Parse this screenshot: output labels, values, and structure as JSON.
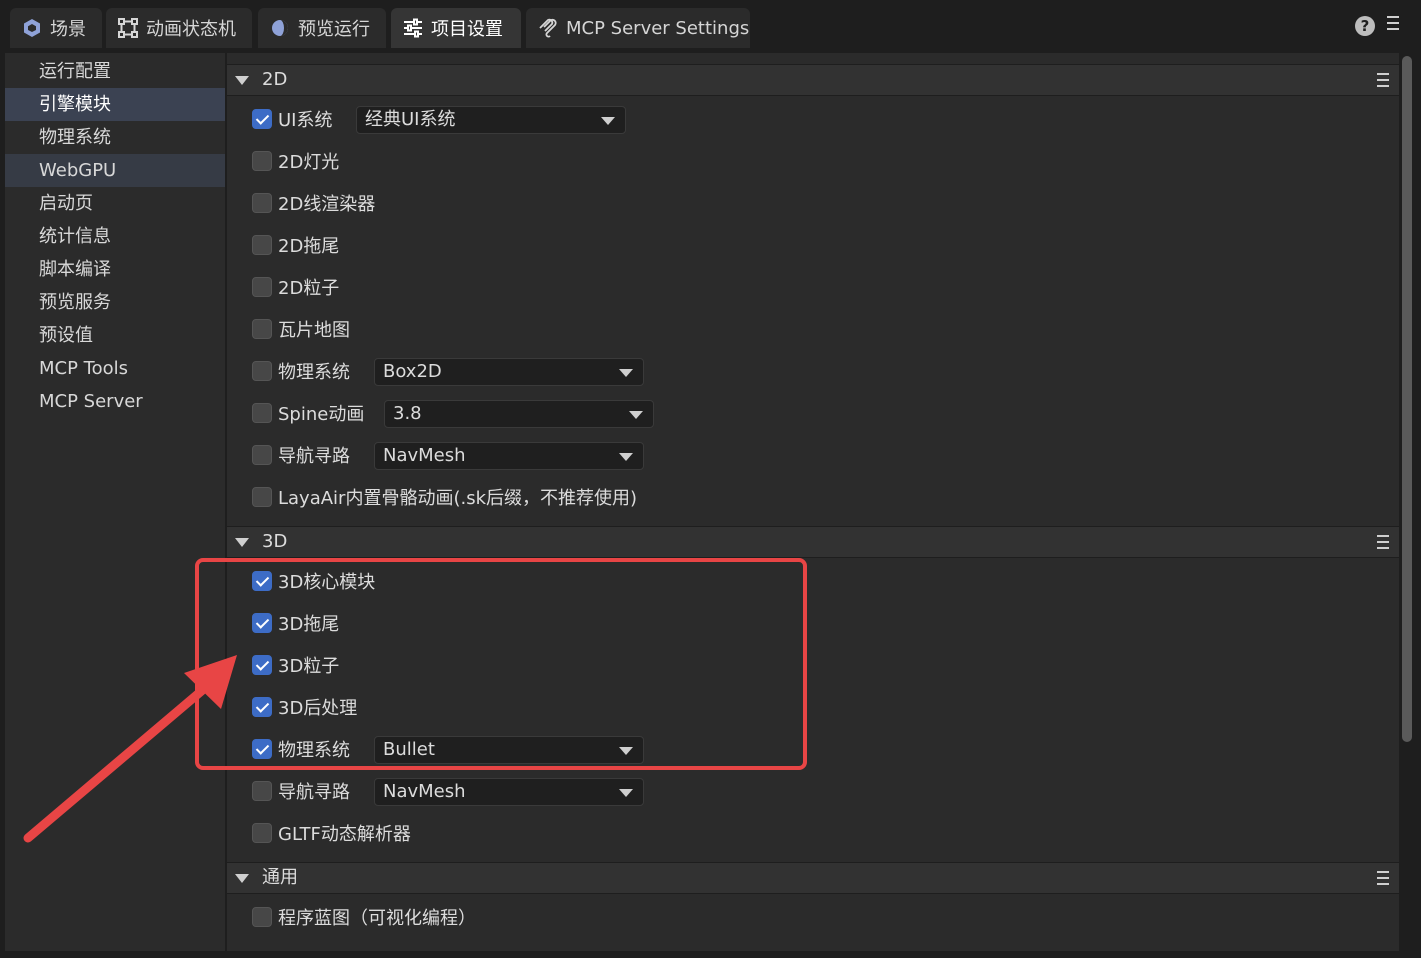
{
  "tabs": [
    {
      "label": "场景",
      "icon": "cube-icon"
    },
    {
      "label": "动画状态机",
      "icon": "state-machine-icon"
    },
    {
      "label": "预览运行",
      "icon": "preview-run-icon"
    },
    {
      "label": "项目设置",
      "icon": "settings-sliders-icon"
    },
    {
      "label": "MCP Server Settings",
      "icon": "mcp-icon"
    }
  ],
  "sidebar": {
    "items": [
      "运行配置",
      "引擎模块",
      "物理系统",
      "WebGPU",
      "启动页",
      "统计信息",
      "脚本编译",
      "预览服务",
      "预设值",
      "MCP Tools",
      "MCP Server"
    ],
    "selected": "引擎模块"
  },
  "sections": {
    "s2d": {
      "title": "2D",
      "items": [
        {
          "label": "UI系统",
          "checked": true,
          "dropdown": "经典UI系统"
        },
        {
          "label": "2D灯光",
          "checked": false
        },
        {
          "label": "2D线渲染器",
          "checked": false
        },
        {
          "label": "2D拖尾",
          "checked": false
        },
        {
          "label": "2D粒子",
          "checked": false
        },
        {
          "label": "瓦片地图",
          "checked": false
        },
        {
          "label": "物理系统",
          "checked": false,
          "dropdown": "Box2D"
        },
        {
          "label": "Spine动画",
          "checked": false,
          "dropdown": "3.8"
        },
        {
          "label": "导航寻路",
          "checked": false,
          "dropdown": "NavMesh"
        },
        {
          "label": "LayaAir内置骨骼动画(.sk后缀，不推荐使用)",
          "checked": false
        }
      ]
    },
    "s3d": {
      "title": "3D",
      "items": [
        {
          "label": "3D核心模块",
          "checked": true
        },
        {
          "label": "3D拖尾",
          "checked": true
        },
        {
          "label": "3D粒子",
          "checked": true
        },
        {
          "label": "3D后处理",
          "checked": true
        },
        {
          "label": "物理系统",
          "checked": true,
          "dropdown": "Bullet"
        },
        {
          "label": "导航寻路",
          "checked": false,
          "dropdown": "NavMesh"
        },
        {
          "label": "GLTF动态解析器",
          "checked": false
        }
      ]
    },
    "general": {
      "title": "通用",
      "items": [
        {
          "label": "程序蓝图（可视化编程）",
          "checked": false
        }
      ]
    }
  },
  "colors": {
    "accent": "#3d6cc6",
    "highlight": "#e84545"
  }
}
